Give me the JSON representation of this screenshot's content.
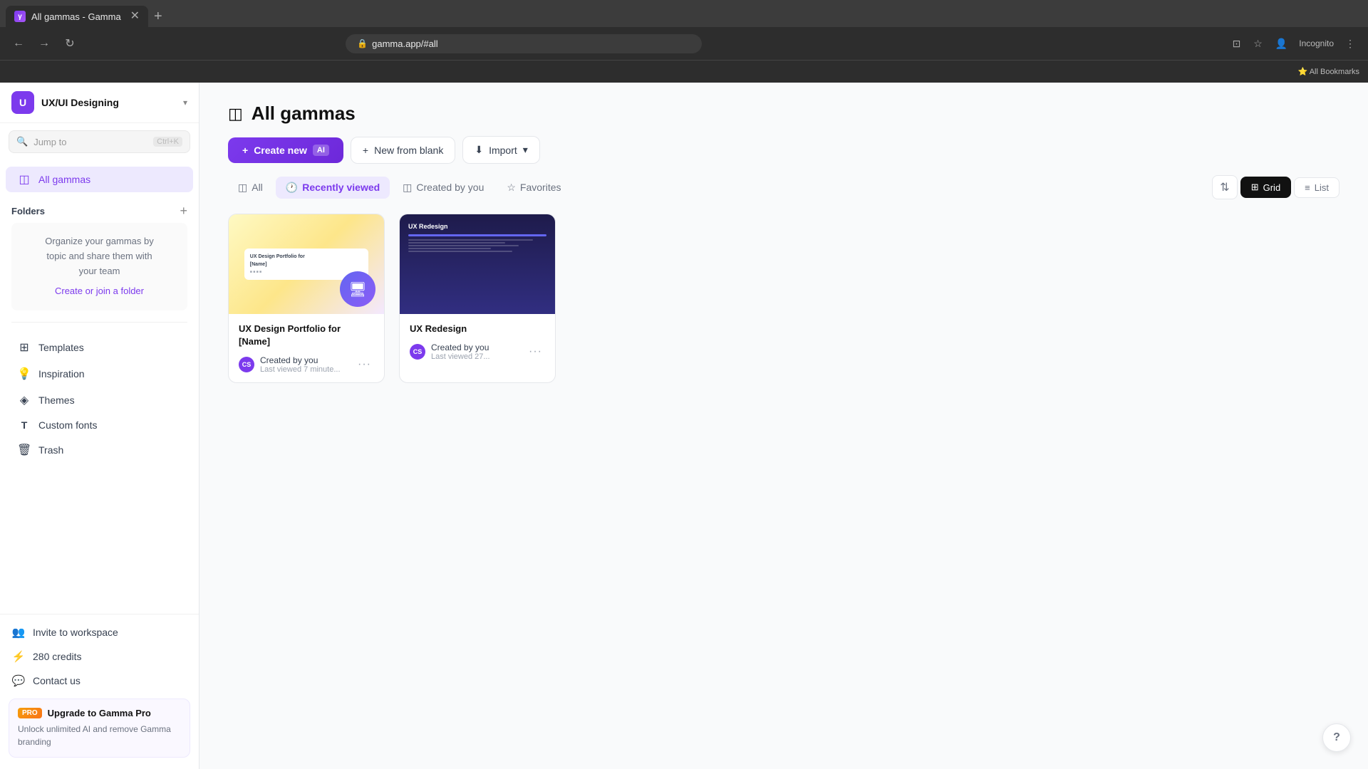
{
  "browser": {
    "tab_title": "All gammas - Gamma",
    "url": "gamma.app/#all",
    "bookmarks_label": "All Bookmarks"
  },
  "sidebar": {
    "workspace_name": "UX/UI Designing",
    "workspace_initial": "U",
    "search_placeholder": "Jump to",
    "search_shortcut": "Ctrl+K",
    "nav_items": [
      {
        "id": "all-gammas",
        "icon": "◫",
        "label": "All gammas",
        "active": true
      }
    ],
    "folders_title": "Folders",
    "folders_empty_text": "Organize your gammas by\ntopic and share them with\nyour team",
    "folders_link": "Create or join a folder",
    "menu_items": [
      {
        "id": "templates",
        "icon": "⊞",
        "label": "Templates"
      },
      {
        "id": "inspiration",
        "icon": "💡",
        "label": "Inspiration"
      },
      {
        "id": "themes",
        "icon": "◈",
        "label": "Themes"
      },
      {
        "id": "custom-fonts",
        "icon": "T",
        "label": "Custom fonts"
      },
      {
        "id": "trash",
        "icon": "🗑",
        "label": "Trash"
      }
    ],
    "bottom_items": [
      {
        "id": "invite",
        "icon": "👥",
        "label": "Invite to workspace"
      },
      {
        "id": "credits",
        "icon": "⚡",
        "label": "280 credits"
      },
      {
        "id": "contact",
        "icon": "💬",
        "label": "Contact us"
      }
    ],
    "upgrade": {
      "badge": "PRO",
      "title": "Upgrade to Gamma Pro",
      "description": "Unlock unlimited AI and remove Gamma branding"
    }
  },
  "main": {
    "title": "All gammas",
    "title_icon": "◫",
    "toolbar": {
      "create_label": "Create new",
      "create_ai_badge": "AI",
      "new_blank_label": "New from blank",
      "import_label": "Import"
    },
    "filter_tabs": [
      {
        "id": "all",
        "icon": "◫",
        "label": "All"
      },
      {
        "id": "recently-viewed",
        "icon": "🕐",
        "label": "Recently viewed",
        "active": true
      },
      {
        "id": "created-by-you",
        "icon": "◫",
        "label": "Created by you"
      },
      {
        "id": "favorites",
        "icon": "☆",
        "label": "Favorites"
      }
    ],
    "view_grid_label": "Grid",
    "view_list_label": "List",
    "cards": [
      {
        "id": "card-1",
        "title": "UX Design Portfolio for [Name]",
        "author": "Created by you",
        "time": "Last viewed 7 minute...",
        "avatar_initials": "CS",
        "preview_type": "light"
      },
      {
        "id": "card-2",
        "title": "UX Redesign",
        "author": "Created by you",
        "time": "Last viewed 27...",
        "avatar_initials": "CS",
        "preview_type": "dark"
      }
    ]
  }
}
